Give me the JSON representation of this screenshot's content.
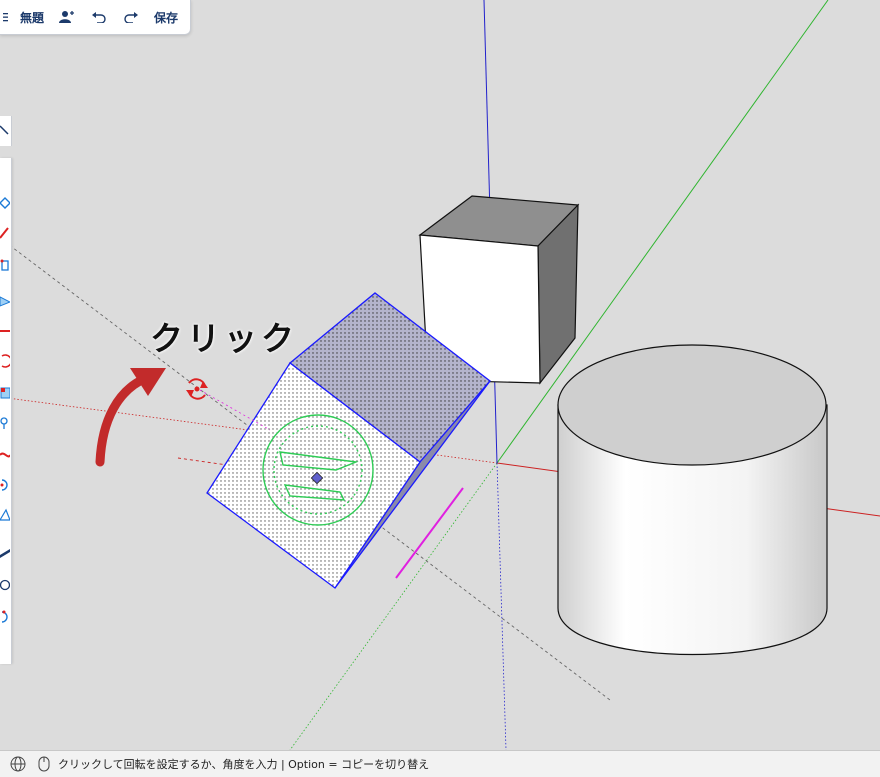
{
  "toolbar": {
    "title": "無題",
    "save_label": "保存",
    "icons": [
      "menu-icon",
      "add-user-icon",
      "undo-icon",
      "redo-icon"
    ]
  },
  "annotation": {
    "text": "クリック",
    "arrow_color": "#c22b2b"
  },
  "left_toolbar": {
    "icons": [
      "select-arrow-icon",
      "eraser-icon",
      "pencil-icon",
      "line-icon",
      "push-pull-icon",
      "move-icon",
      "rotate-icon",
      "scale-icon",
      "paint-icon",
      "tape-measure-icon",
      "follow-me-icon",
      "offset-icon",
      "section-icon",
      "orbit-icon",
      "zoom-icon"
    ]
  },
  "status": {
    "message": "クリックして回転を設定するか、角度を入力 | Option = コピーを切り替え",
    "icons": [
      "globe-icon",
      "mouse-icon"
    ]
  },
  "colors": {
    "background": "#dcdcdc",
    "selection": "#1a1aff",
    "protractor": "#2ecc55",
    "axis_red": "#cc2222",
    "axis_green": "#2fb52f",
    "axis_blue": "#2222cc",
    "inference_magenta": "#e020e0"
  }
}
